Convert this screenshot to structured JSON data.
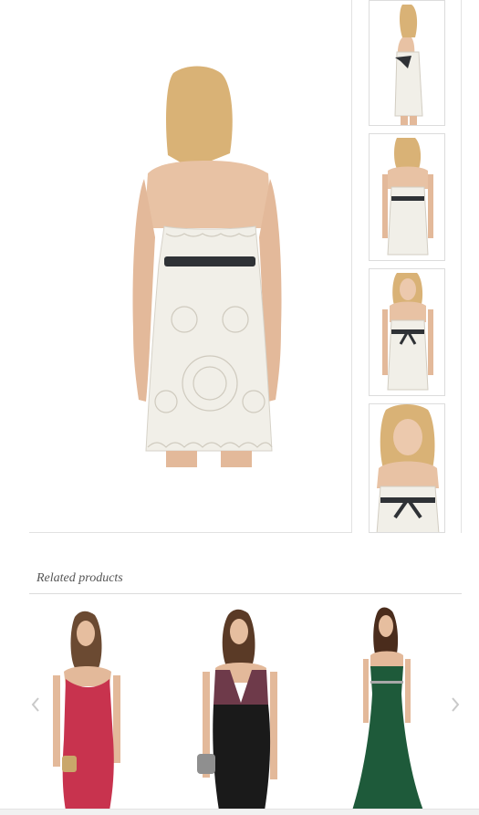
{
  "related": {
    "title": "Related products"
  },
  "icons": {
    "prev": "chevron-left-icon",
    "next": "chevron-right-icon"
  },
  "colors": {
    "dress_white": "#f1efe8",
    "sash": "#2f3236",
    "skin": "#e8c2a4",
    "hair": "#d9b276",
    "red_dress": "#c8334e",
    "plum": "#6e3a4a",
    "black": "#1a1a1a",
    "green": "#1e5a3a"
  }
}
